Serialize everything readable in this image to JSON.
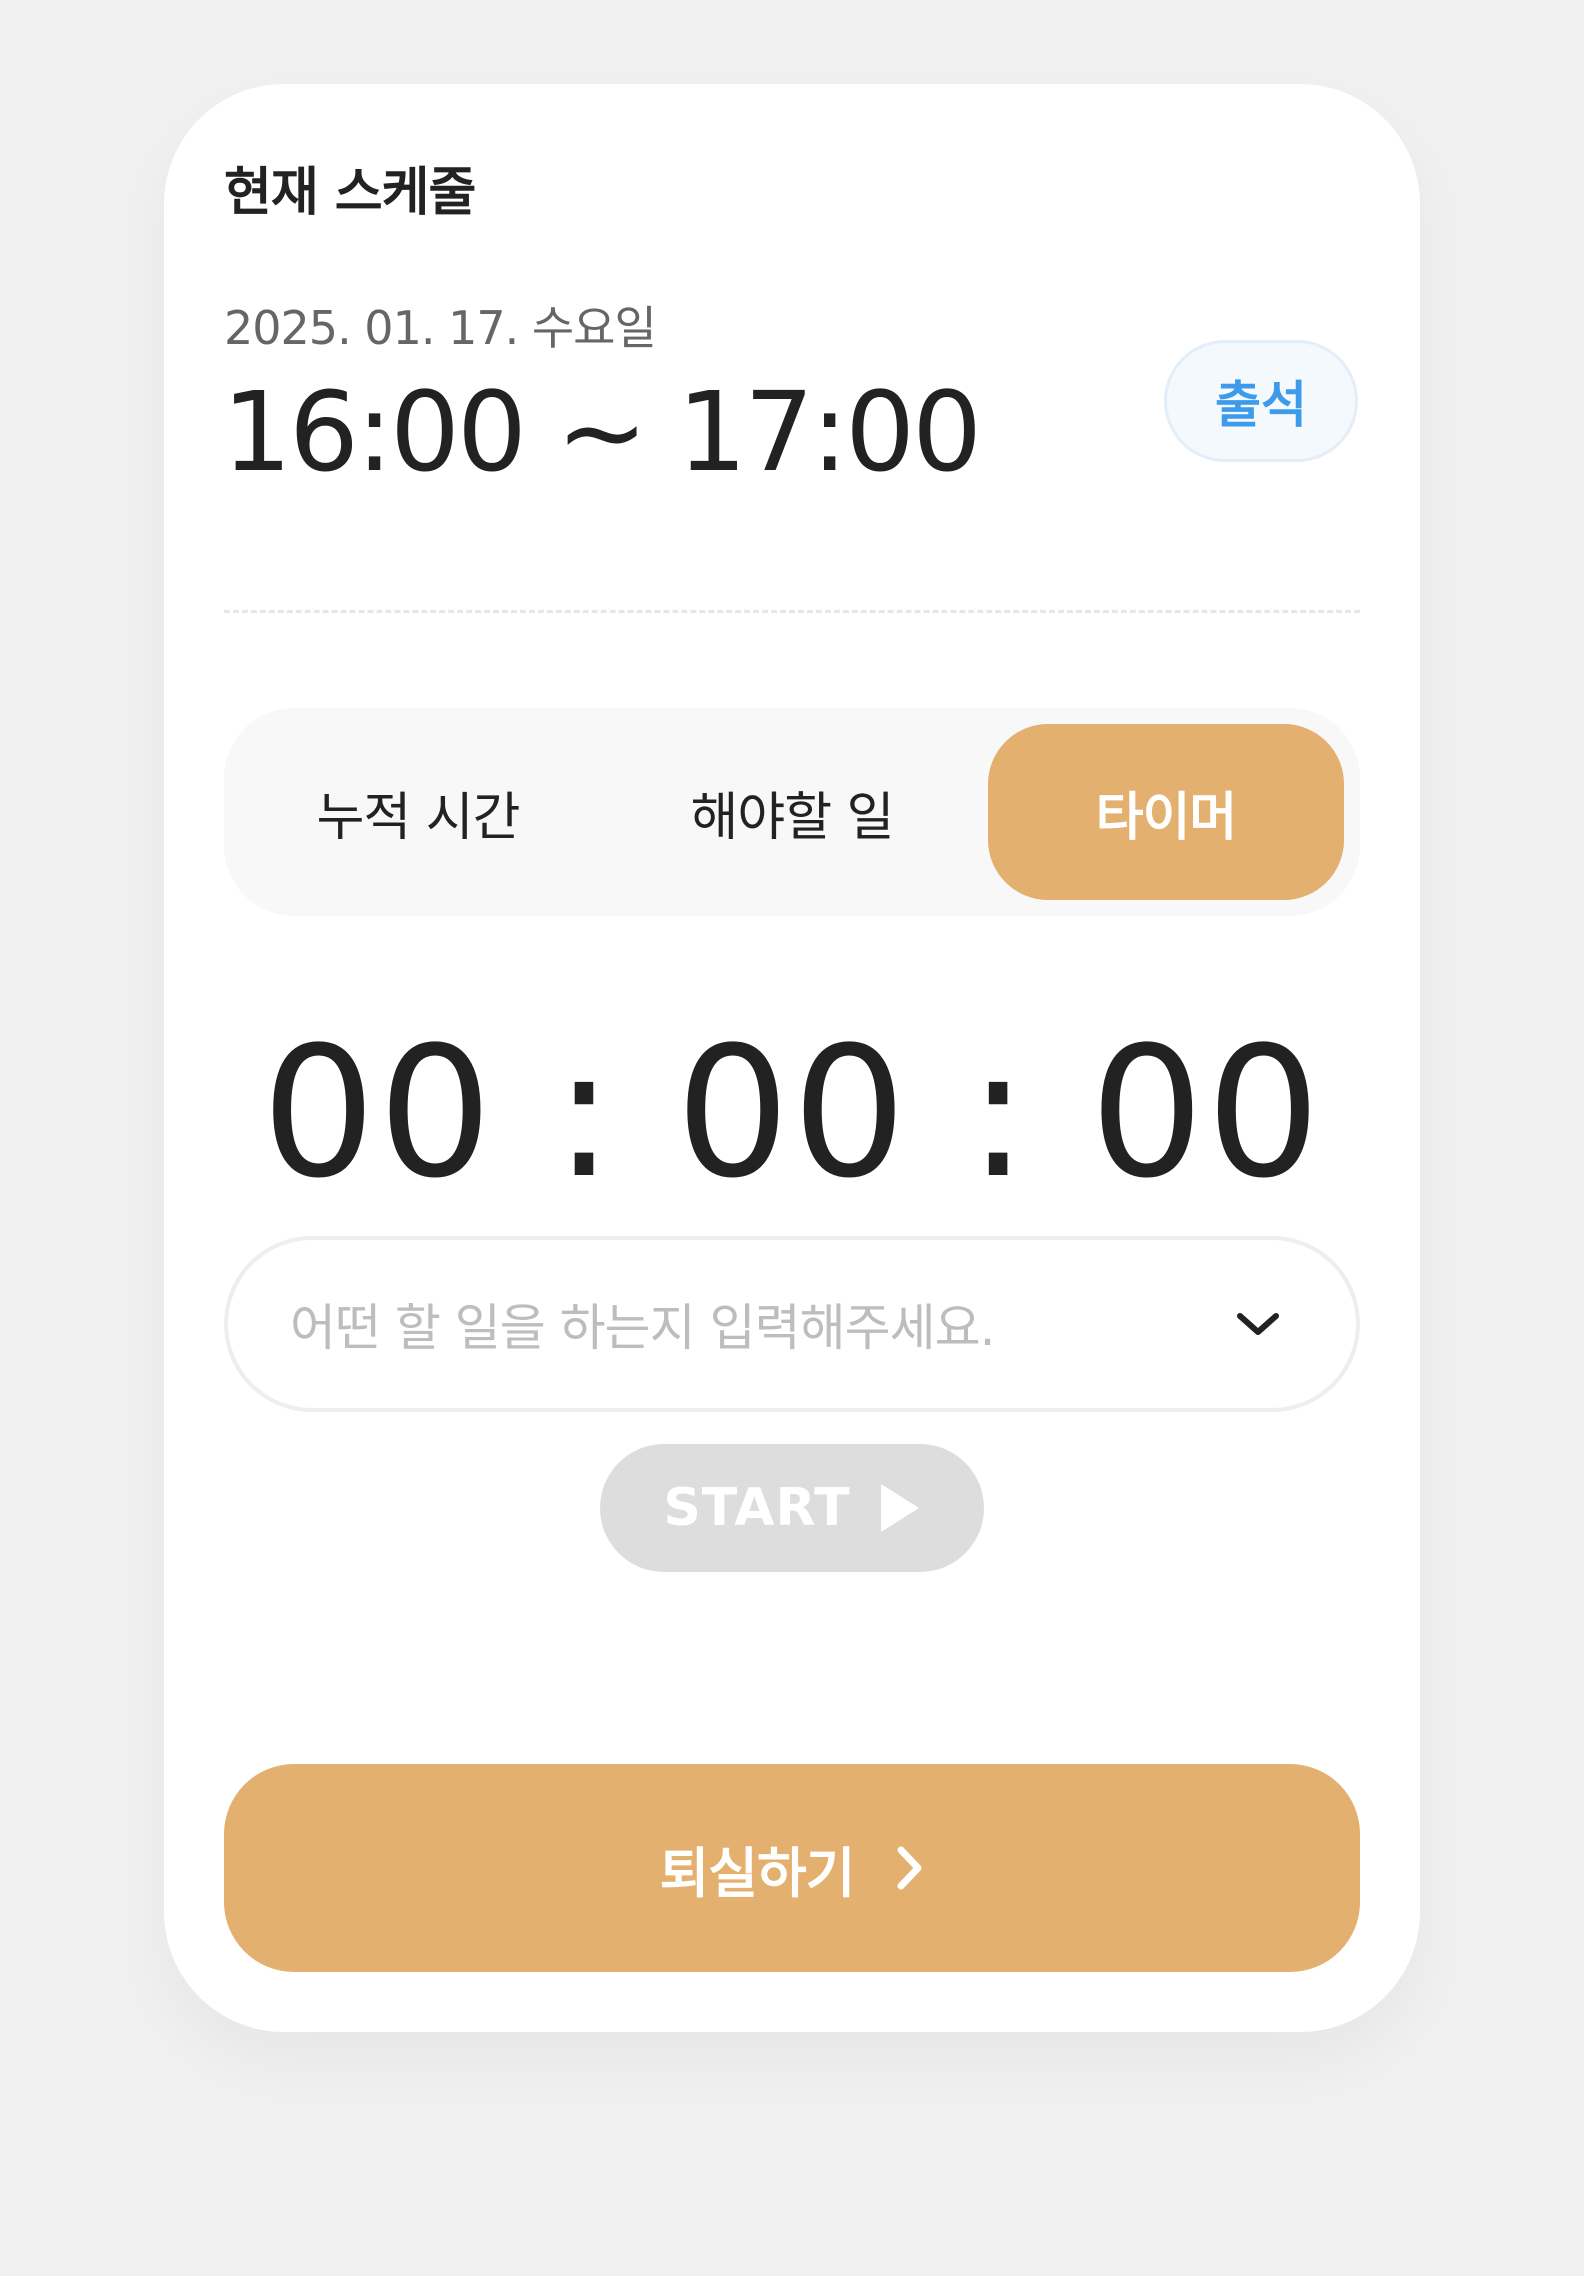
{
  "card": {
    "title": "현재 스케줄",
    "date": "2025. 01. 17. 수요일",
    "time_range": "16:00 ~ 17:00",
    "attend_label": "출석"
  },
  "tabs": [
    {
      "label": "누적 시간",
      "active": false
    },
    {
      "label": "해야할 일",
      "active": false
    },
    {
      "label": "타이머",
      "active": true
    }
  ],
  "timer": {
    "display": "00 : 00 : 00"
  },
  "task_select": {
    "placeholder": "어떤 할 일을 하는지 입력해주세요.",
    "icon": "chevron-down-icon"
  },
  "start_button": {
    "label": "START",
    "icon": "play-icon"
  },
  "leave_button": {
    "label": "퇴실하기",
    "icon": "chevron-right-icon"
  },
  "colors": {
    "accent": "#e3b06f",
    "attend_text": "#3d9be9",
    "disabled": "#dddddd",
    "background": "#f0f0f0"
  }
}
